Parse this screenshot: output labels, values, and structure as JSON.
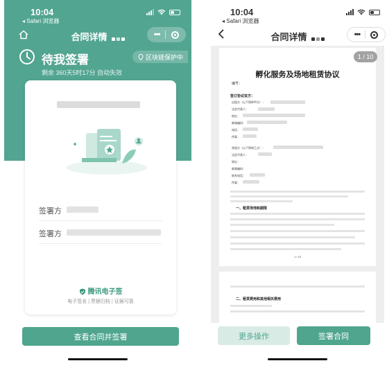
{
  "status_bar": {
    "time": "10:04",
    "back_app": "◂ Safari 浏览器"
  },
  "left": {
    "nav_title": "合同详情",
    "status_title": "待我签署",
    "status_sub": "剩余 360天5时17分 自动失效",
    "chain_badge": "区块链保护中",
    "signers": [
      {
        "label": "签署方"
      },
      {
        "label": "签署方"
      }
    ],
    "brand": "腾讯电子签",
    "brand_links": "电子签名 | 票据归档 | 证据可靠",
    "main_button": "查看合同并签署"
  },
  "right": {
    "nav_title": "合同详情",
    "page_indicator": "1 / 10",
    "doc": {
      "title": "孵化服务及场地租赁协议",
      "number": "编号：",
      "section_parties": "签订协议双方：",
      "party_a_fields": [
        "出租方（以下简称甲方）：",
        "法定代表人：",
        "地址：",
        "邮政编码：",
        "电话：",
        "传真："
      ],
      "party_b_fields": [
        "承租方（以下简称乙方）：",
        "法定代表人：",
        "地址：",
        "邮政编码：",
        "联系电话：",
        "传真："
      ],
      "section_1": "一、租赁场地和期限",
      "section_2": "二、租赁费用和其他相关费用",
      "page_mark": "1 / 10"
    },
    "more_button": "更多操作",
    "sign_button": "签署合同"
  },
  "colors": {
    "accent": "#4fa58e",
    "header_green": "#52a591"
  },
  "icons": [
    "home-icon",
    "clock-icon",
    "location-pin-icon",
    "back-chevron-icon",
    "more-dots-icon",
    "target-icon",
    "shield-logo-icon"
  ]
}
